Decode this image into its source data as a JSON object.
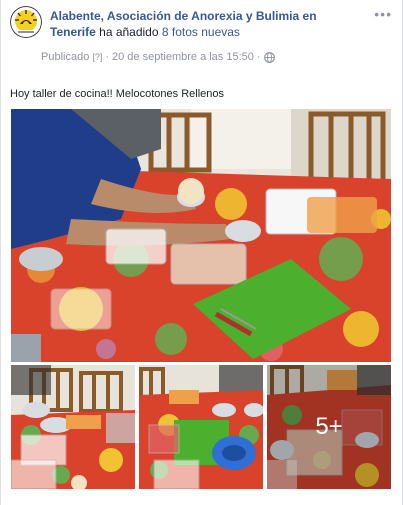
{
  "post": {
    "page_name": "Alabente, Asociación de Anorexia y Bulimia en Tenerife",
    "action_verb": "ha añadido",
    "action_object": "8 fotos nuevas",
    "meta": {
      "prefix": "Publicado",
      "help": "[?]",
      "separator1": "·",
      "date": "20 de septiembre a las 15:50",
      "separator2": "·",
      "privacy_icon": "globe-icon"
    },
    "more_menu": "•••",
    "caption": "Hoy taller de cocina!! Melocotones Rellenos",
    "more_photos_label": "5+"
  },
  "colors": {
    "link": "#365899",
    "meta": "#90949c",
    "text": "#1d2129"
  }
}
